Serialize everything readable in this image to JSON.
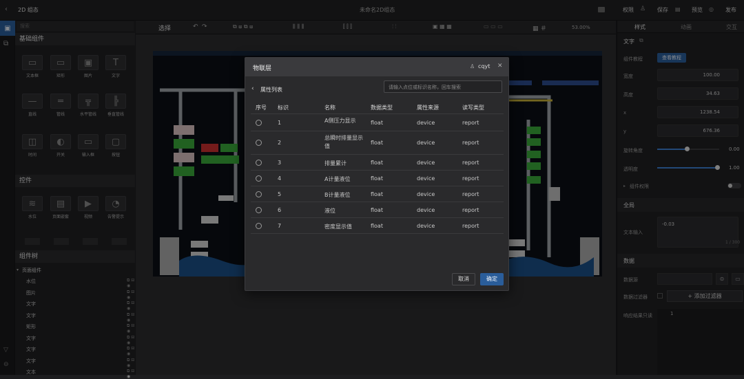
{
  "topbar": {
    "back_icon": "chevron-left-icon",
    "app_title": "2D 组态",
    "doc_title": "未命名2D组态",
    "permission": "权限",
    "save": "保存",
    "preview": "预览",
    "publish": "发布"
  },
  "left": {
    "search_placeholder": "搜索",
    "basic_section": "基础组件",
    "basic": [
      {
        "label": "文本框",
        "icon": "▭"
      },
      {
        "label": "矩形",
        "icon": "▭"
      },
      {
        "label": "图片",
        "icon": "▣"
      },
      {
        "label": "文字",
        "icon": "T"
      },
      {
        "label": "直线",
        "icon": "—"
      },
      {
        "label": "管线",
        "icon": "═"
      },
      {
        "label": "水平管线",
        "icon": "╦"
      },
      {
        "label": "垂直管线",
        "icon": "╠"
      },
      {
        "label": "时间",
        "icon": "◫"
      },
      {
        "label": "开关",
        "icon": "◐"
      },
      {
        "label": "输入框",
        "icon": "▭"
      },
      {
        "label": "按钮",
        "icon": "▢"
      }
    ],
    "control_section": "控件",
    "controls": [
      {
        "label": "水位",
        "icon": "≋"
      },
      {
        "label": "页面嵌套",
        "icon": "▤"
      },
      {
        "label": "视频",
        "icon": "▶"
      },
      {
        "label": "告警提示",
        "icon": "◔"
      }
    ],
    "tree_section": "组件树",
    "tree_root": "页面组件",
    "tree_items": [
      "水位",
      "图片",
      "文字",
      "文字",
      "矩形",
      "文字",
      "文字",
      "文字",
      "文本"
    ]
  },
  "toolbar": {
    "select": "选择",
    "zoom": "53.00%"
  },
  "right": {
    "tabs": [
      "样式",
      "动画",
      "交互"
    ],
    "section_text": "文字",
    "tutorial_label": "组件教程",
    "tutorial_btn": "查看教程",
    "width_label": "宽度",
    "width": "100.00",
    "height_label": "高度",
    "height": "34.63",
    "x_label": "x",
    "x": "1238.54",
    "y_label": "y",
    "y": "676.36",
    "rotate_label": "旋转角度",
    "rotate": "0.00",
    "opacity_label": "透明度",
    "opacity": "1.00",
    "perm_label": "组件权限",
    "global_section": "全局",
    "text_input_label": "文本输入",
    "text_input": "-0.03",
    "text_count": "1 / 300",
    "data_section": "数据",
    "datasource_label": "数据源",
    "filter_label": "数据过滤器",
    "add_filter": "+ 添加过滤器",
    "response_label": "响应结果只读",
    "response_line": "1"
  },
  "modal": {
    "title": "物联层",
    "user": "cqyt",
    "list_title": "属性列表",
    "search_placeholder": "请输入点位或标识名称，回车搜索",
    "columns": [
      "序号",
      "标识",
      "名称",
      "数据类型",
      "属性来源",
      "读写类型"
    ],
    "rows": [
      {
        "index": "1",
        "name": "A侧压力显示",
        "type": "float",
        "source": "device",
        "rw": "report"
      },
      {
        "index": "2",
        "name": "总瞬时排量显示值",
        "type": "float",
        "source": "device",
        "rw": "report"
      },
      {
        "index": "3",
        "name": "排量累计",
        "type": "float",
        "source": "device",
        "rw": "report"
      },
      {
        "index": "4",
        "name": "A计量液位",
        "type": "float",
        "source": "device",
        "rw": "report"
      },
      {
        "index": "5",
        "name": "B计量液位",
        "type": "float",
        "source": "device",
        "rw": "report"
      },
      {
        "index": "6",
        "name": "液位",
        "type": "float",
        "source": "device",
        "rw": "report"
      },
      {
        "index": "7",
        "name": "密度显示值",
        "type": "float",
        "source": "device",
        "rw": "report"
      }
    ],
    "cancel": "取消",
    "confirm": "确定"
  }
}
